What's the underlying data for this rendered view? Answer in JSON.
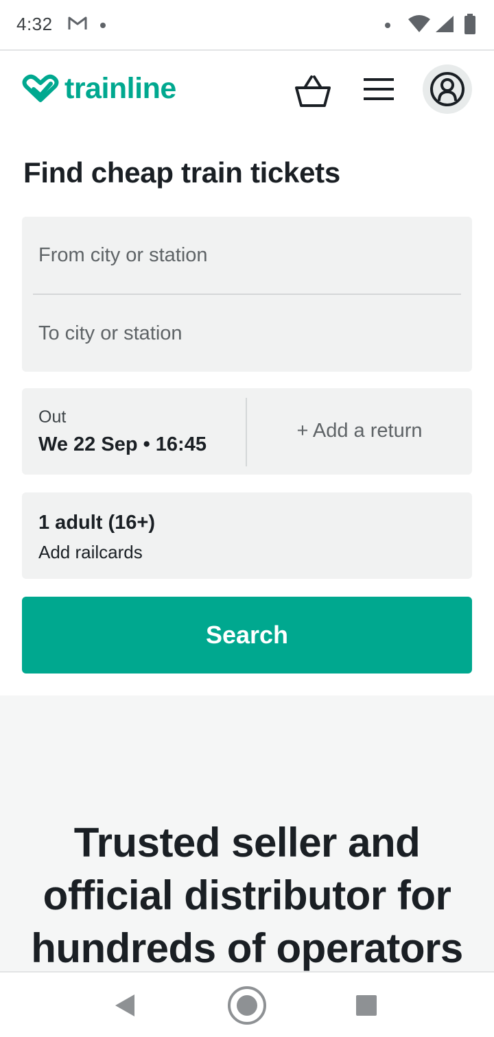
{
  "status_bar": {
    "time": "4:32",
    "icons": [
      "gmail-icon",
      "notification-dot-icon",
      "wifi-icon",
      "signal-icon",
      "battery-icon"
    ]
  },
  "header": {
    "brand": "trainline",
    "brand_color": "#00a88f",
    "icons": [
      "trainline-logo-icon",
      "basket-icon",
      "menu-icon",
      "account-icon"
    ]
  },
  "main": {
    "title": "Find cheap train tickets",
    "from_placeholder": "From city or station",
    "to_placeholder": "To city or station",
    "out_label": "Out",
    "out_value": "We 22 Sep • 16:45",
    "add_return": "+ Add a return",
    "passengers": "1 adult (16+)",
    "railcards": "Add railcards",
    "search_label": "Search"
  },
  "trusted": {
    "heading_lines": [
      "Trusted seller and",
      "official distributor for",
      "hundreds of operators"
    ]
  },
  "nav_bar": {
    "icons": [
      "back-icon",
      "home-icon",
      "recents-icon"
    ]
  }
}
